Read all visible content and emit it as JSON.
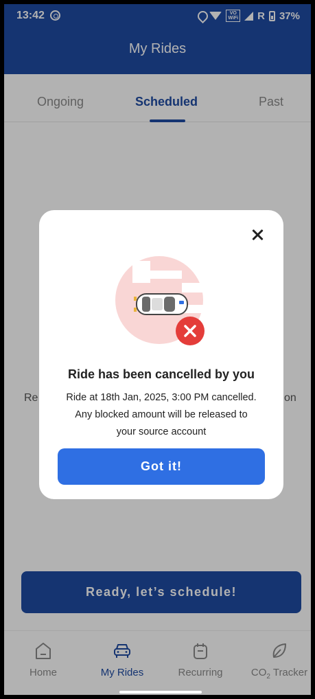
{
  "status_bar": {
    "time": "13:42",
    "indicators": "R",
    "battery": "37%",
    "vowifi_top": "VO",
    "vowifi_bottom": "WiFi"
  },
  "header": {
    "title": "My Rides"
  },
  "tabs": [
    {
      "label": "Ongoing",
      "active": false
    },
    {
      "label": "Scheduled",
      "active": true
    },
    {
      "label": "Past",
      "active": false
    }
  ],
  "background": {
    "left_fragment": "Re",
    "right_fragment": "on",
    "schedule_button": "Ready, let’s schedule!"
  },
  "modal": {
    "title": "Ride has been cancelled by you",
    "message_line1": "Ride at  18th Jan, 2025, 3:00 PM cancelled.",
    "message_line2": "Any blocked amount will be released to",
    "message_line3": "your source account",
    "button": "Got it!"
  },
  "bottom_nav": [
    {
      "label": "Home",
      "icon": "home-icon",
      "active": false
    },
    {
      "label": "My Rides",
      "icon": "car-icon",
      "active": true
    },
    {
      "label": "Recurring",
      "icon": "calendar-icon",
      "active": false
    },
    {
      "label": "CO",
      "sub": "2",
      "suffix": " Tracker",
      "icon": "leaf-icon",
      "active": false
    }
  ],
  "colors": {
    "primary": "#1f4ba3",
    "button_blue": "#2f6fe3",
    "error_red": "#e43d3a",
    "illustration_pink": "#f9d6d5"
  }
}
